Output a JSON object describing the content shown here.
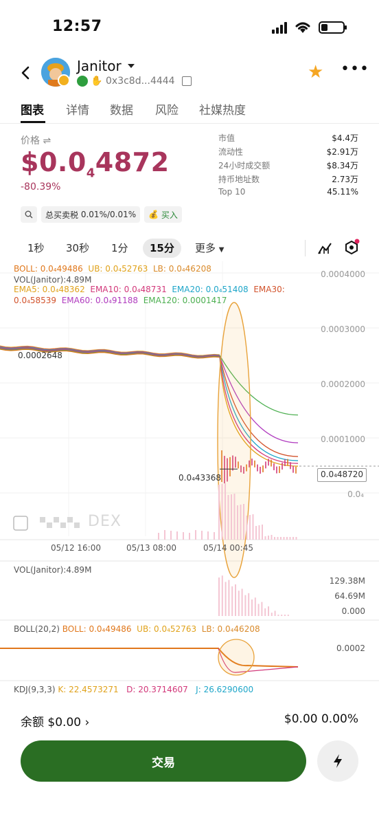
{
  "status_bar": {
    "time": "12:57"
  },
  "header": {
    "token_name": "Janitor",
    "address": "0x3c8d...4444"
  },
  "tabs": [
    {
      "label": "图表"
    },
    {
      "label": "详情"
    },
    {
      "label": "数据"
    },
    {
      "label": "风险"
    },
    {
      "label": "社媒热度"
    }
  ],
  "price": {
    "label": "价格 ⇌",
    "prefix": "$0.0",
    "zeros": "4",
    "digits": "4872",
    "change": "-80.39%"
  },
  "stats": [
    {
      "label": "市值",
      "value": "$4.4万"
    },
    {
      "label": "流动性",
      "value": "$2.91万"
    },
    {
      "label": "24小时成交额",
      "value": "$8.34万"
    },
    {
      "label": "持币地址数",
      "value": "2.73万"
    },
    {
      "label": "Top 10",
      "value": "45.11%"
    }
  ],
  "tax": {
    "label": "总买卖税",
    "value": "0.01%/0.01%",
    "buy": "买入"
  },
  "intervals": [
    {
      "label": "1秒"
    },
    {
      "label": "30秒"
    },
    {
      "label": "1分"
    },
    {
      "label": "15分"
    },
    {
      "label": "更多"
    }
  ],
  "indicators": {
    "boll_line": {
      "boll": "BOLL: 0.0₄49486",
      "ub": "UB: 0.0₄52763",
      "lb": "LB: 0.0₄46208"
    },
    "vol_line": "VOL(Janitor):4.89M",
    "ema_line1": {
      "ema5": "EMA5: 0.0₄48362",
      "ema10": "EMA10: 0.0₄48731",
      "ema20": "EMA20: 0.0₄51408",
      "ema30": "EMA30:"
    },
    "ema_line2": {
      "ema30v": "0.0₄58539",
      "ema60": "EMA60: 0.0₄91188",
      "ema120": "EMA120: 0.0001417"
    }
  },
  "chart_data": {
    "type": "line",
    "price_axis_ticks": [
      "0.0004000",
      "0.0003000",
      "0.0002000",
      "0.0001000",
      "0.0₄"
    ],
    "x_ticks": [
      "05/12 16:00",
      "05/13 08:00",
      "05/14 00:45"
    ],
    "pre_crash_label": "0.0002648",
    "low_label": "0.0₄43368",
    "current_label": "0.0₄48720",
    "watermark": "DEX",
    "series": [
      {
        "color": "#d98a2b",
        "values": [
          0.0002648,
          0.00026,
          0.000255,
          0.00025,
          0.000245,
          0.000242,
          4.33e-05,
          5.5e-05,
          5.2e-05,
          4.87e-05
        ]
      }
    ]
  },
  "vol_panel": {
    "label": "VOL(Janitor):4.89M",
    "ticks": [
      "129.38M",
      "64.69M",
      "0.000"
    ]
  },
  "boll_panel": {
    "label": "BOLL(20,2)",
    "boll": "BOLL: 0.0₄49486",
    "ub": "UB: 0.0₄52763",
    "lb": "LB: 0.0₄46208",
    "tick": "0.0002"
  },
  "kdj_panel": {
    "label": "KDJ(9,3,3)",
    "k": "K: 22.4573271",
    "d": "D: 20.3714607",
    "j": "J: 26.6290600"
  },
  "footer": {
    "balance_label": "余额 $0.00",
    "balance_right": "$0.00 0.00%",
    "trade_label": "交易"
  }
}
